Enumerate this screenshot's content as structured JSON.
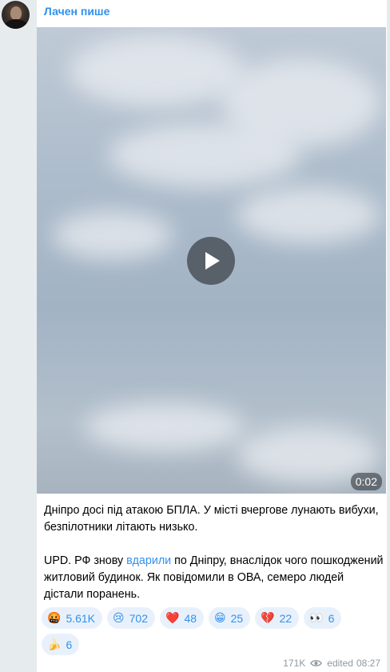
{
  "channel": {
    "author": "Лачен пише"
  },
  "video": {
    "duration": "0:02"
  },
  "post": {
    "p1": "Дніпро досі під атакою БПЛА. У місті вчергове лунають вибухи, безпілотники літають низько.",
    "p2_before": "UPD. РФ знову ",
    "p2_link": "вдарили",
    "p2_after": " по Дніпру, внаслідок чого пошкоджений житловий будинок. Як повідомили в ОВА, семеро людей дістали поранень."
  },
  "reactions": [
    {
      "emoji": "🤬",
      "count": "5.61K",
      "icon": "angry-face-icon"
    },
    {
      "emoji": "😢",
      "count": "702",
      "icon": "crying-face-icon"
    },
    {
      "emoji": "❤️",
      "count": "48",
      "icon": "red-heart-icon"
    },
    {
      "emoji": "😁",
      "count": "25",
      "icon": "grinning-face-icon"
    },
    {
      "emoji": "💔",
      "count": "22",
      "icon": "broken-heart-icon"
    },
    {
      "emoji": "👀",
      "count": "6",
      "icon": "eyes-icon"
    },
    {
      "emoji": "🍌",
      "count": "6",
      "icon": "banana-icon"
    }
  ],
  "meta": {
    "views": "171K",
    "edited": "edited",
    "time": "08:27"
  },
  "colors": {
    "accent": "#3390ec",
    "background": "#e6ebee",
    "meta": "#8f989f"
  }
}
